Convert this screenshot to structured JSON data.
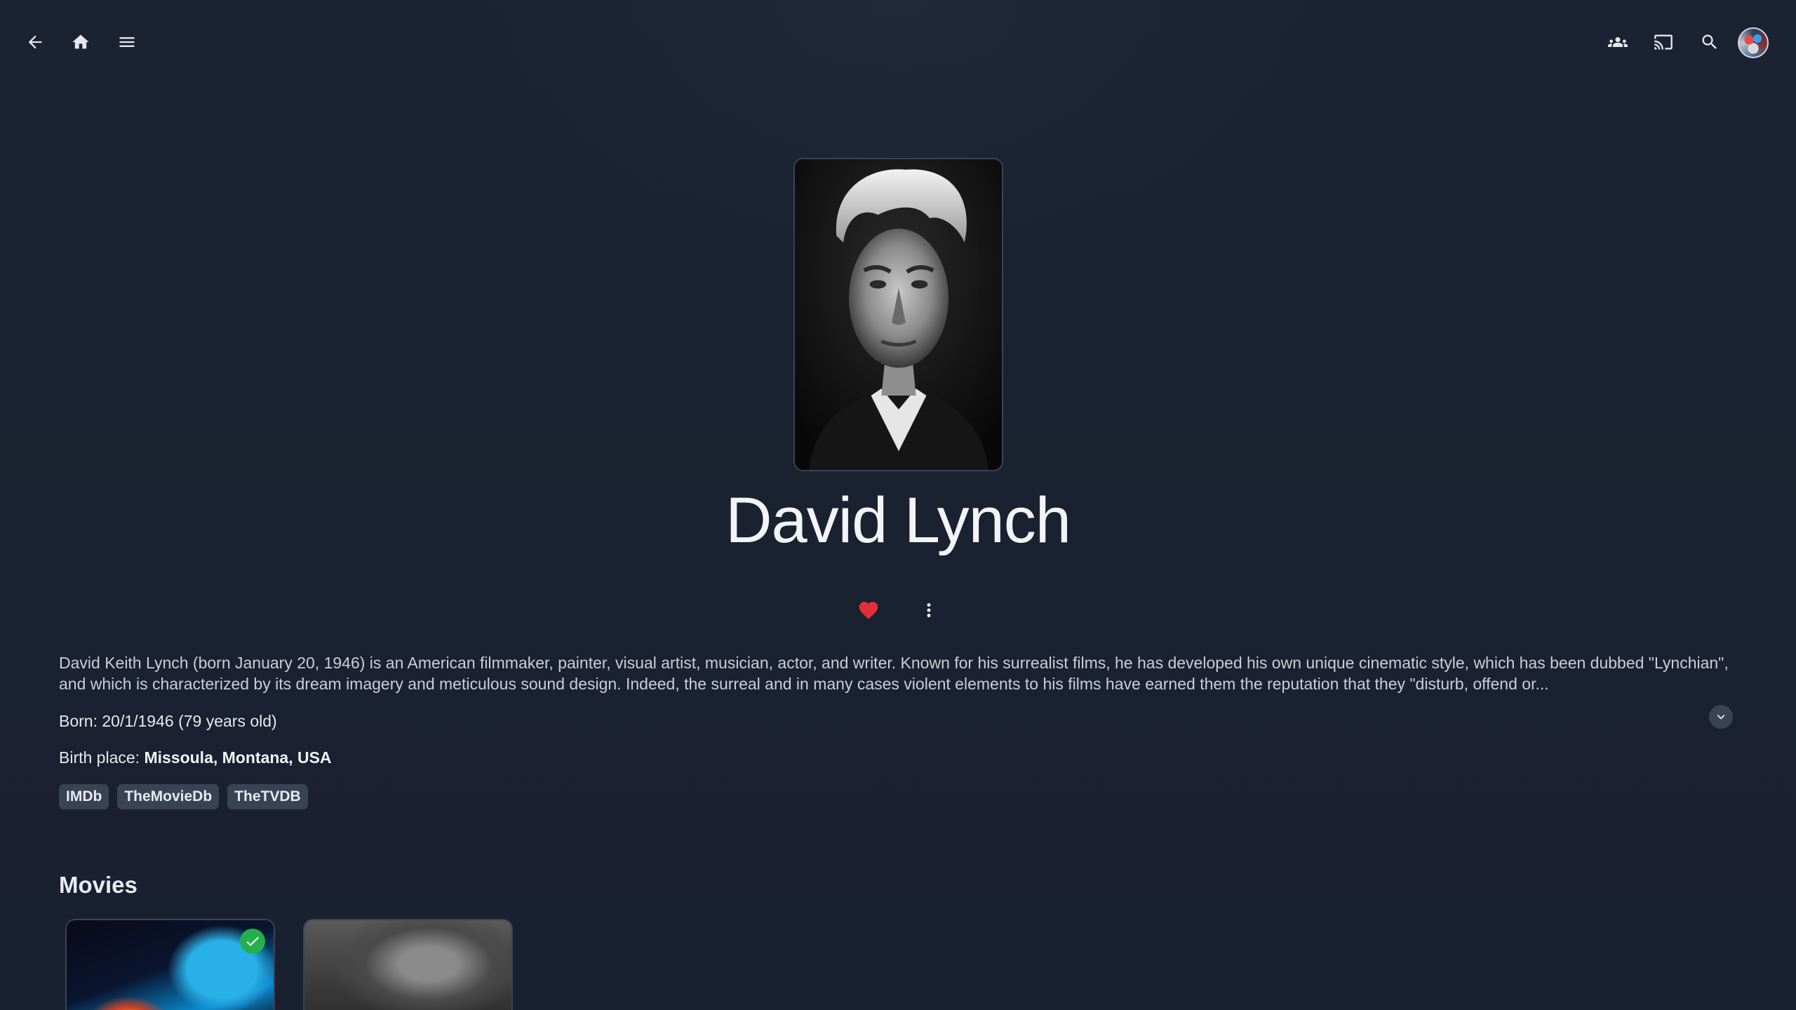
{
  "app": {
    "header": {
      "icons": {
        "back": "arrow-back-icon",
        "home": "home-icon",
        "menu": "menu-icon",
        "users": "users-icon",
        "cast": "cast-icon",
        "search": "search-icon"
      }
    }
  },
  "person": {
    "name": "David Lynch",
    "overview": "David Keith Lynch (born January 20, 1946) is an American filmmaker, painter, visual artist, musician, actor, and writer. Known for his surrealist films, he has developed his own unique cinematic style, which has been dubbed \"Lynchian\", and which is characterized by its dream imagery and meticulous sound design. Indeed, the surreal and in many cases violent elements to his films have earned them the reputation that they \"disturb, offend or...",
    "born": "Born: 20/1/1946 (79 years old)",
    "birth_place_label": "Birth place: ",
    "birth_place_value": "Missoula, Montana, USA",
    "is_favorite": true,
    "favorite_color": "#e0313b"
  },
  "external_links": [
    "IMDb",
    "TheMovieDb",
    "TheTVDB"
  ],
  "sections": {
    "movies_title": "Movies"
  },
  "movies": [
    {
      "watched": true
    },
    {
      "watched": false
    }
  ],
  "colors": {
    "background": "#1a2130",
    "chip": "#3a4354",
    "watched_badge": "#22b14c"
  }
}
